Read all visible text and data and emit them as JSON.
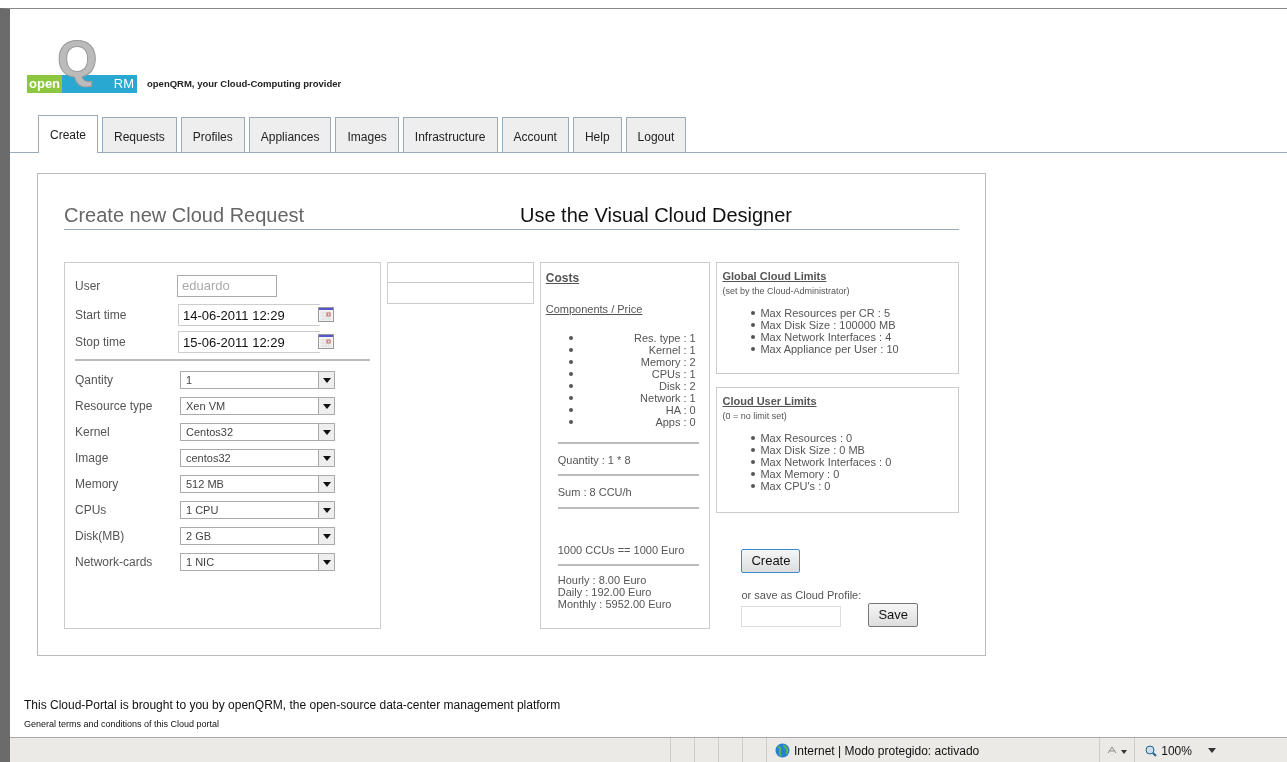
{
  "header": {
    "logo": {
      "left": "open",
      "middle": "Q",
      "right": "RM"
    },
    "tagline": "openQRM, your Cloud-Computing provider"
  },
  "tabs": [
    {
      "label": "Create",
      "selected": true
    },
    {
      "label": "Requests",
      "selected": false
    },
    {
      "label": "Profiles",
      "selected": false
    },
    {
      "label": "Appliances",
      "selected": false
    },
    {
      "label": "Images",
      "selected": false
    },
    {
      "label": "Infrastructure",
      "selected": false
    },
    {
      "label": "Account",
      "selected": false
    },
    {
      "label": "Help",
      "selected": false
    },
    {
      "label": "Logout",
      "selected": false
    }
  ],
  "form": {
    "title": "Create new Cloud Request",
    "designer_link": "Use the Visual Cloud Designer",
    "user": {
      "label": "User",
      "value": "eduardo",
      "disabled": true
    },
    "times": [
      {
        "label": "Start time",
        "value": "14-06-2011 12:29"
      },
      {
        "label": "Stop time",
        "value": "15-06-2011 12:29"
      }
    ],
    "selects": [
      {
        "label": "Qantity",
        "value": "1"
      },
      {
        "label": "Resource type",
        "value": "Xen VM"
      },
      {
        "label": "Kernel",
        "value": "Centos32"
      },
      {
        "label": "Image",
        "value": "centos32"
      },
      {
        "label": "Memory",
        "value": "512 MB"
      },
      {
        "label": "CPUs",
        "value": "1 CPU"
      },
      {
        "label": "Disk(MB)",
        "value": "2 GB"
      },
      {
        "label": "Network-cards",
        "value": "1 NIC"
      }
    ]
  },
  "costs": {
    "title": "Costs",
    "subtitle": "Components / Price",
    "items": [
      "Res. type : 1",
      "Kernel : 1",
      "Memory : 2",
      "CPUs : 1",
      "Disk : 2",
      "Network : 1",
      "HA : 0",
      "Apps : 0"
    ],
    "quantity": "Quantity : 1 * 8",
    "sum": "Sum : 8 CCU/h",
    "rate": "1000 CCUs == 1000 Euro",
    "prices": [
      "Hourly : 8.00 Euro",
      "Daily : 192.00 Euro",
      "Monthly : 5952.00 Euro"
    ]
  },
  "limits": [
    {
      "title": "Global Cloud Limits",
      "note": "(set by the Cloud-Administrator)",
      "items": [
        "Max Resources per CR : 5",
        "Max Disk Size : 100000 MB",
        "Max Network Interfaces : 4",
        "Max Appliance per User : 10"
      ]
    },
    {
      "title": "Cloud User Limits",
      "note": "(0 = no limit set)",
      "items": [
        "Max Resources : 0",
        "Max Disk Size : 0 MB",
        "Max Network Interfaces : 0",
        "Max Memory : 0",
        "Max CPU's : 0"
      ]
    }
  ],
  "actions": {
    "create": "Create",
    "save_label": "or save as Cloud Profile:",
    "save": "Save"
  },
  "footer": {
    "text": "This Cloud-Portal is brought to you by openQRM, the open-source data-center management platform",
    "terms": "General terms and conditions of this Cloud portal"
  },
  "status_bar": {
    "zone": "Internet | Modo protegido: activado",
    "zoom": "100%"
  }
}
